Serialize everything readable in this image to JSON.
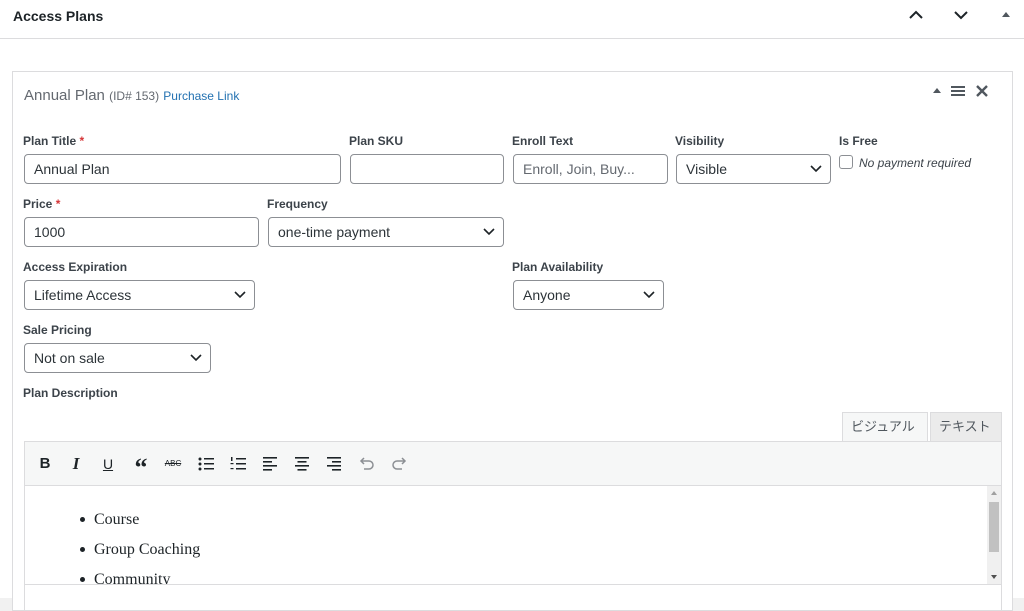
{
  "panel": {
    "title": "Access Plans"
  },
  "plan": {
    "name": "Annual Plan",
    "id_text": "(ID# 153)",
    "purchase_link": "Purchase Link"
  },
  "fields": {
    "plan_title": {
      "label": "Plan Title",
      "required": "*",
      "value": "Annual Plan"
    },
    "plan_sku": {
      "label": "Plan SKU",
      "value": ""
    },
    "enroll_text": {
      "label": "Enroll Text",
      "placeholder": "Enroll, Join, Buy..."
    },
    "visibility": {
      "label": "Visibility",
      "value": "Visible"
    },
    "is_free": {
      "label": "Is Free",
      "checkbox_label": "No payment required"
    },
    "price": {
      "label": "Price",
      "required": "*",
      "value": "1000"
    },
    "frequency": {
      "label": "Frequency",
      "value": "one-time payment"
    },
    "access_expiration": {
      "label": "Access Expiration",
      "value": "Lifetime Access"
    },
    "plan_availability": {
      "label": "Plan Availability",
      "value": "Anyone"
    },
    "sale_pricing": {
      "label": "Sale Pricing",
      "value": "Not on sale"
    },
    "plan_description": {
      "label": "Plan Description"
    }
  },
  "editor": {
    "tabs": [
      "ビジュアル",
      "テキスト"
    ],
    "toolbar": [
      "bold",
      "italic",
      "underline",
      "blockquote",
      "strikethrough",
      "bullet-list",
      "numbered-list",
      "align-left",
      "align-center",
      "align-right",
      "undo",
      "redo"
    ],
    "content_items": [
      "Course",
      "Group Coaching",
      "Community"
    ]
  },
  "colors": {
    "link": "#2271b1",
    "required": "#d63638",
    "border": "#dcdcde"
  }
}
